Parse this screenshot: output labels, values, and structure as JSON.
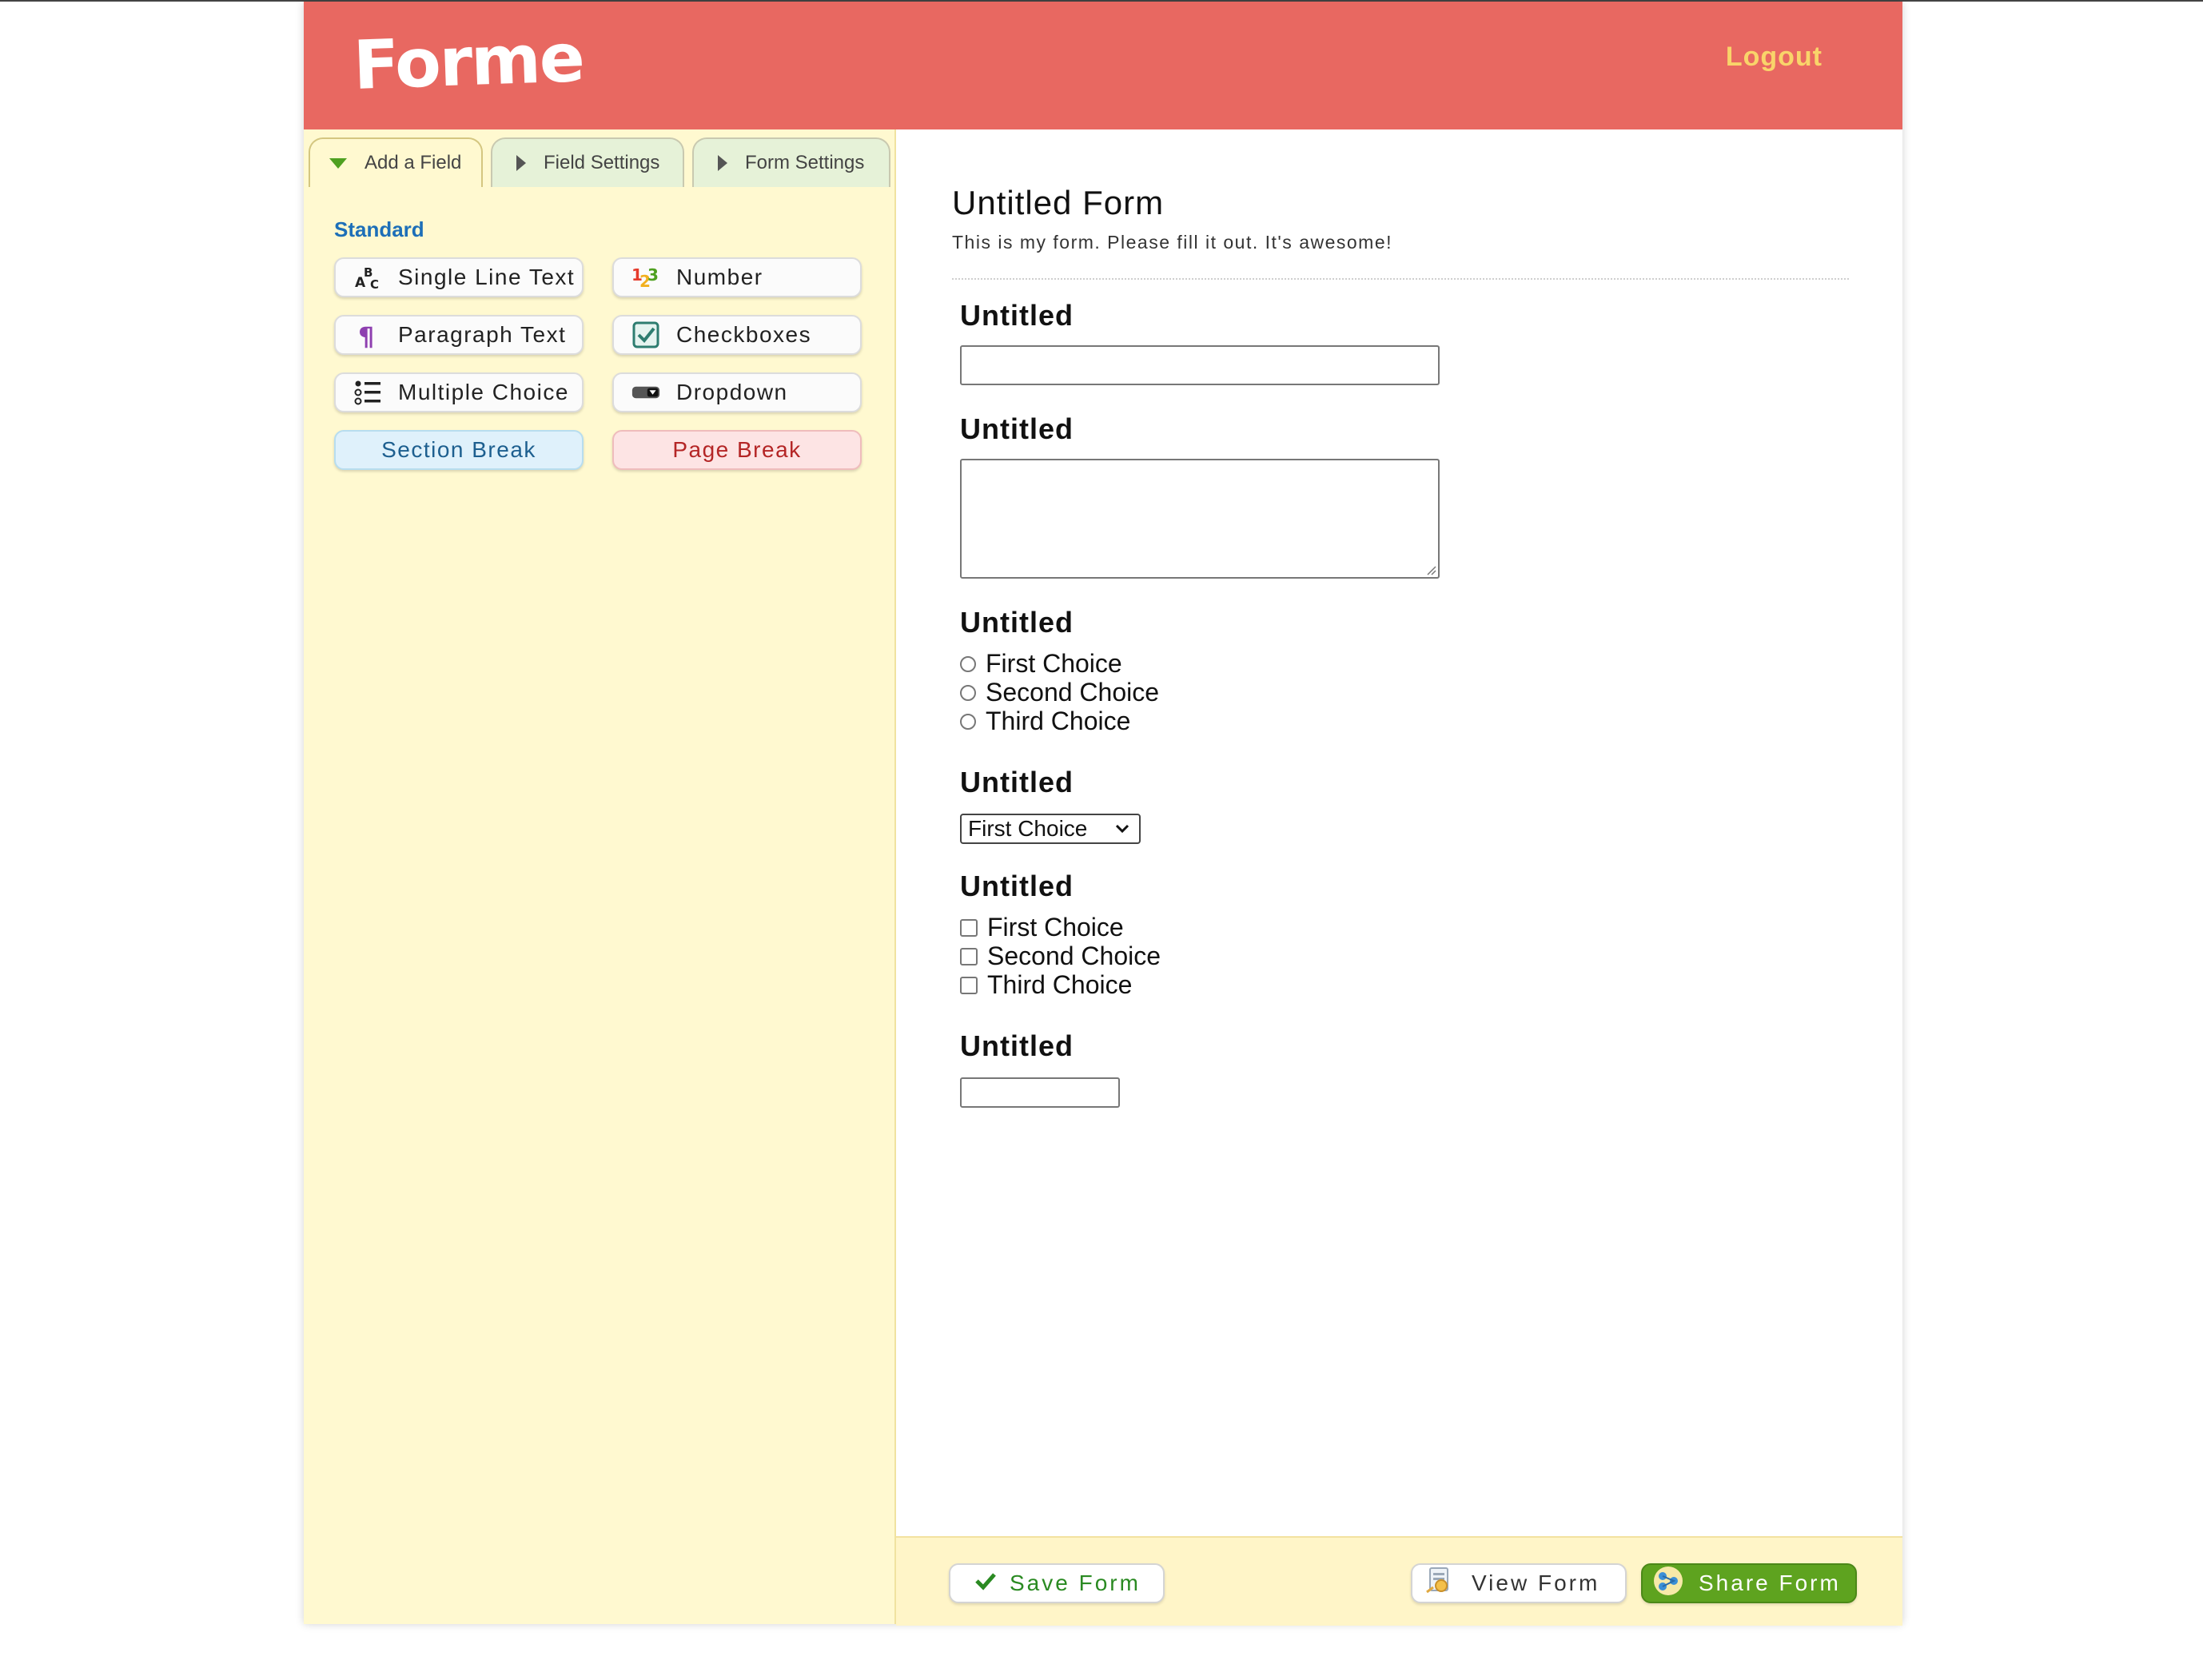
{
  "header": {
    "logo": "Forme",
    "logout_label": "Logout"
  },
  "sidebar": {
    "tabs": [
      {
        "label": "Add a Field",
        "icon": "triangle-down-icon",
        "active": true
      },
      {
        "label": "Field Settings",
        "icon": "triangle-right-icon"
      },
      {
        "label": "Form Settings",
        "icon": "triangle-right-icon"
      }
    ],
    "section_title": "Standard",
    "fields": [
      {
        "label": "Single Line Text",
        "icon": "abc-icon"
      },
      {
        "label": "Number",
        "icon": "numbers-icon"
      },
      {
        "label": "Paragraph Text",
        "icon": "pilcrow-icon"
      },
      {
        "label": "Checkboxes",
        "icon": "checkbox-icon"
      },
      {
        "label": "Multiple Choice",
        "icon": "list-icon"
      },
      {
        "label": "Dropdown",
        "icon": "dropdown-icon"
      },
      {
        "label": "Section Break"
      },
      {
        "label": "Page Break"
      }
    ]
  },
  "form": {
    "title": "Untitled Form",
    "description": "This is my form. Please fill it out. It's awesome!",
    "fields": [
      {
        "label": "Untitled",
        "type": "text",
        "value": ""
      },
      {
        "label": "Untitled",
        "type": "textarea",
        "value": ""
      },
      {
        "label": "Untitled",
        "type": "radio",
        "options": [
          "First Choice",
          "Second Choice",
          "Third Choice"
        ]
      },
      {
        "label": "Untitled",
        "type": "select",
        "selected": "First Choice"
      },
      {
        "label": "Untitled",
        "type": "checkbox",
        "options": [
          "First Choice",
          "Second Choice",
          "Third Choice"
        ]
      },
      {
        "label": "Untitled",
        "type": "number",
        "value": ""
      }
    ]
  },
  "footer": {
    "save_label": "Save Form",
    "view_label": "View Form",
    "share_label": "Share Form"
  },
  "colors": {
    "header": "#e86861",
    "logout": "#f9d46a",
    "sidebar": "#fff9d0",
    "share": "#5ea31f",
    "link": "#1d6fb8"
  }
}
